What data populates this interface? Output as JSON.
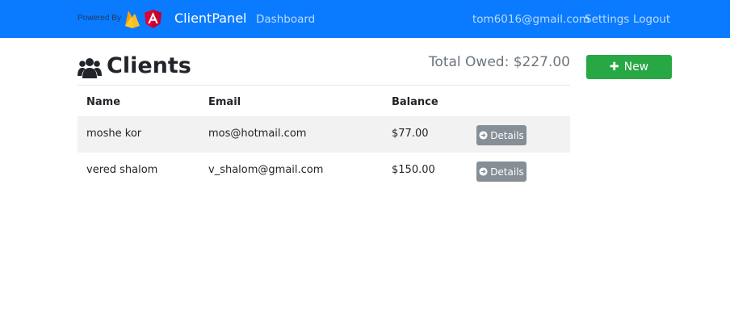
{
  "navbar": {
    "powered_by": "Powered By",
    "brand": "ClientPanel",
    "links": {
      "dashboard": "Dashboard",
      "email": "tom6016@gmail.com",
      "settings": "Settings",
      "logout": "Logout"
    },
    "colors": {
      "background": "#0a7bff"
    }
  },
  "header": {
    "title": "Clients",
    "icon": "users-icon",
    "total_owed": "Total Owed: $227.00",
    "new_button": "New"
  },
  "table": {
    "columns": [
      "Name",
      "Email",
      "Balance"
    ],
    "rows": [
      {
        "name": "moshe kor",
        "email": "mos@hotmail.com",
        "balance": "$77.00",
        "action": "Details"
      },
      {
        "name": "vered shalom",
        "email": "v_shalom@gmail.com",
        "balance": "$150.00",
        "action": "Details"
      }
    ]
  },
  "colors": {
    "new_button": "#28a745",
    "details_button": "#868e96",
    "striped_row": "#f2f2f2"
  }
}
